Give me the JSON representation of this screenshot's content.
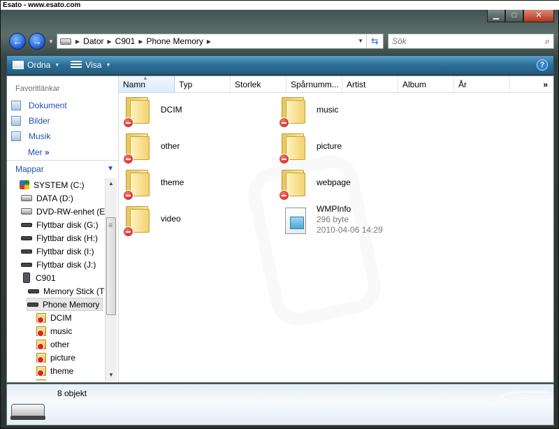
{
  "window": {
    "title": "Esato - www.esato.com"
  },
  "address": {
    "crumbs": [
      "Dator",
      "C901",
      "Phone Memory"
    ]
  },
  "search": {
    "placeholder": "Sök"
  },
  "toolbar": {
    "organize_label": "Ordna",
    "view_label": "Visa"
  },
  "favorites": {
    "heading": "Favoritlänkar",
    "links": [
      {
        "label": "Dokument"
      },
      {
        "label": "Bilder"
      },
      {
        "label": "Musik"
      }
    ],
    "more_label": "Mer"
  },
  "folders": {
    "heading": "Mappar",
    "tree": [
      {
        "label": "SYSTEM (C:)",
        "icon": "windows-drive-icon"
      },
      {
        "label": "DATA (D:)",
        "icon": "hard-drive-icon"
      },
      {
        "label": "DVD-RW-enhet (E:",
        "icon": "dvd-drive-icon"
      },
      {
        "label": "Flyttbar disk (G:)",
        "icon": "removable-disk-icon"
      },
      {
        "label": "Flyttbar disk (H:)",
        "icon": "removable-disk-icon"
      },
      {
        "label": "Flyttbar disk (I:)",
        "icon": "removable-disk-icon"
      },
      {
        "label": "Flyttbar disk (J:)",
        "icon": "removable-disk-icon"
      },
      {
        "label": "C901",
        "icon": "phone-icon"
      },
      {
        "label": "Memory Stick (T",
        "icon": "memory-stick-icon"
      },
      {
        "label": "Phone Memory",
        "icon": "phone-memory-icon"
      },
      {
        "label": "DCIM",
        "icon": "restricted-folder-icon"
      },
      {
        "label": "music",
        "icon": "restricted-folder-icon"
      },
      {
        "label": "other",
        "icon": "restricted-folder-icon"
      },
      {
        "label": "picture",
        "icon": "restricted-folder-icon"
      },
      {
        "label": "theme",
        "icon": "restricted-folder-icon"
      }
    ]
  },
  "columns": [
    "Namn",
    "Typ",
    "Storlek",
    "Spårnumm...",
    "Artist",
    "Album",
    "År"
  ],
  "more_columns": "»",
  "items": [
    {
      "name": "DCIM"
    },
    {
      "name": "music"
    },
    {
      "name": "other"
    },
    {
      "name": "picture"
    },
    {
      "name": "theme"
    },
    {
      "name": "webpage"
    },
    {
      "name": "video"
    }
  ],
  "file": {
    "name": "WMPInfo",
    "size": "296 byte",
    "date": "2010-04-06 14:29"
  },
  "details": {
    "count": "8 objekt"
  }
}
